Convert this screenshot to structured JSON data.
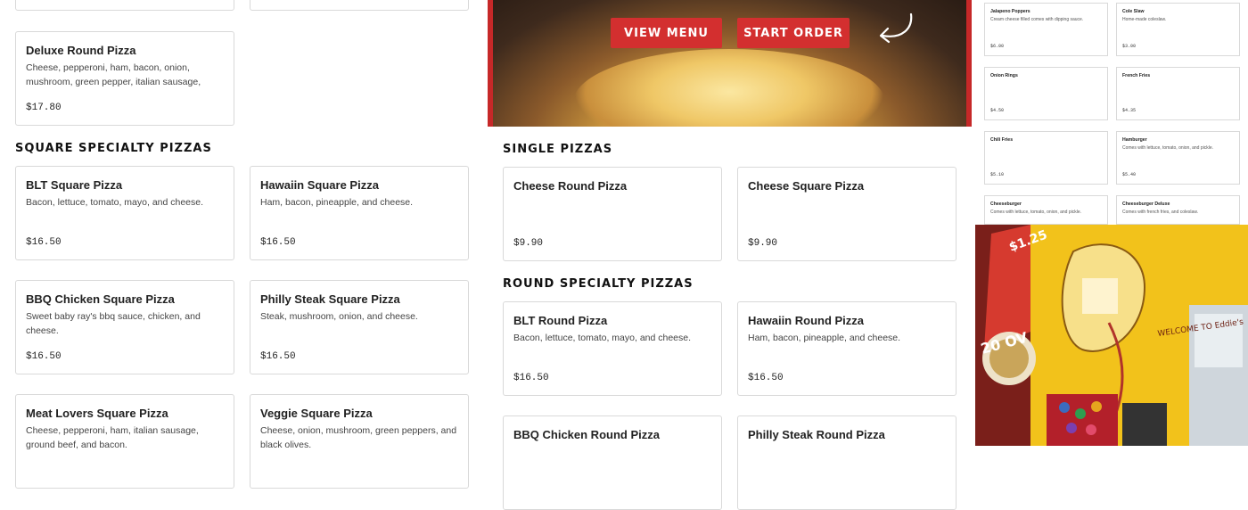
{
  "left_column": {
    "deluxe": {
      "name": "Deluxe Round Pizza",
      "desc": "Cheese, pepperoni, ham, bacon, onion, mushroom, green pepper, italian sausage, ground beef",
      "price": "$17.80"
    },
    "section_title": "Square Specialty Pizzas",
    "items": [
      {
        "name": "BLT Square Pizza",
        "desc": "Bacon, lettuce, tomato, mayo, and cheese.",
        "price": "$16.50"
      },
      {
        "name": "Hawaiin Square Pizza",
        "desc": "Ham, bacon, pineapple, and cheese.",
        "price": "$16.50"
      },
      {
        "name": "BBQ Chicken Square Pizza",
        "desc": "Sweet baby ray's bbq sauce, chicken, and cheese.",
        "price": "$16.50"
      },
      {
        "name": "Philly Steak Square Pizza",
        "desc": "Steak, mushroom, onion, and cheese.",
        "price": "$16.50"
      },
      {
        "name": "Meat Lovers Square Pizza",
        "desc": "Cheese, pepperoni, ham, italian sausage, ground beef, and bacon.",
        "price": ""
      },
      {
        "name": "Veggie Square Pizza",
        "desc": "Cheese, onion, mushroom, green peppers, and black olives.",
        "price": ""
      }
    ]
  },
  "hero": {
    "view_menu": "View Menu",
    "start_order": "Start Order"
  },
  "middle_column": {
    "single_title": "Single Pizzas",
    "singles": [
      {
        "name": "Cheese Round Pizza",
        "price": "$9.90"
      },
      {
        "name": "Cheese Square Pizza",
        "price": "$9.90"
      }
    ],
    "round_title": "Round Specialty Pizzas",
    "rounds": [
      {
        "name": "BLT Round Pizza",
        "desc": "Bacon, lettuce, tomato, mayo, and cheese.",
        "price": "$16.50"
      },
      {
        "name": "Hawaiin Round Pizza",
        "desc": "Ham, bacon, pineapple, and cheese.",
        "price": "$16.50"
      },
      {
        "name": "BBQ Chicken Round Pizza",
        "desc": "",
        "price": ""
      },
      {
        "name": "Philly Steak Round Pizza",
        "desc": "",
        "price": ""
      }
    ]
  },
  "mini_menu": [
    {
      "name": "Jalapeno Poppers",
      "desc": "Cream cheese filled comes with dipping sauce.",
      "price": "$6.00"
    },
    {
      "name": "Cole Slaw",
      "desc": "Home-made coleslaw.",
      "price": "$3.00"
    },
    {
      "name": "Onion Rings",
      "desc": "",
      "price": "$4.50"
    },
    {
      "name": "French Fries",
      "desc": "",
      "price": "$4.35"
    },
    {
      "name": "Chili Fries",
      "desc": "",
      "price": "$5.10"
    },
    {
      "name": "Hamburger",
      "desc": "Comes with lettuce, tomato, onion, and pickle.",
      "price": "$5.40"
    },
    {
      "name": "Cheeseburger",
      "desc": "Comes with lettuce, tomato, onion, and pickle.",
      "price": ""
    },
    {
      "name": "Cheeseburger Deluxe",
      "desc": "Comes with french fries, and coleslaw.",
      "price": ""
    }
  ],
  "photo": {
    "sign_text": "WELCOME TO Eddie's",
    "price_tag": "$1.25",
    "deal_text": "20 OV"
  },
  "colors": {
    "accent": "#d32f2f",
    "border": "#d9d9d9"
  }
}
